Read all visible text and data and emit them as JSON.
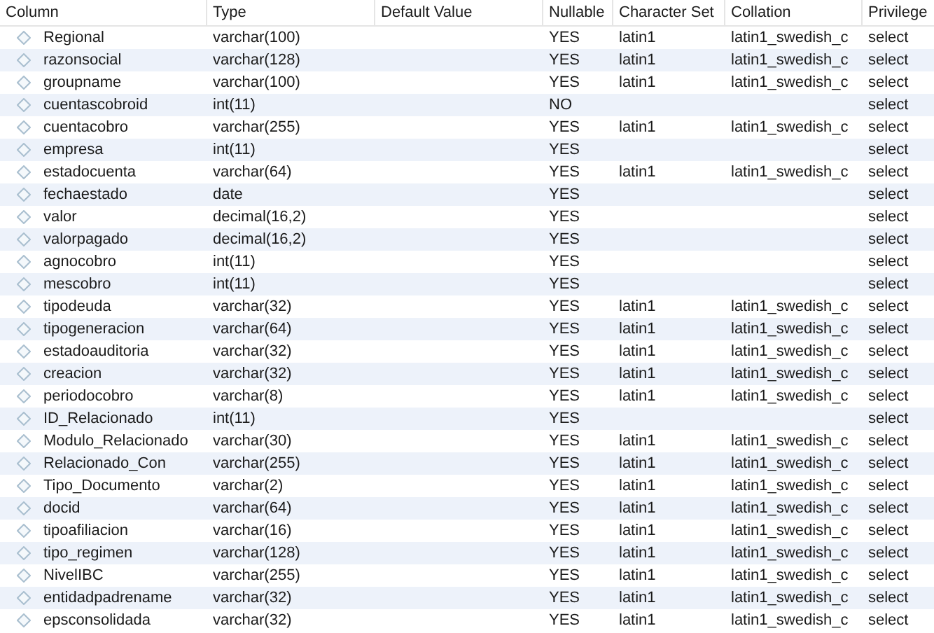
{
  "columns": [
    "Column",
    "Type",
    "Default Value",
    "Nullable",
    "Character Set",
    "Collation",
    "Privilege"
  ],
  "rows": [
    {
      "name": "Regional",
      "type": "varchar(100)",
      "nullable": "YES",
      "charset": "latin1",
      "collation": "latin1_swedish_c",
      "privileges": "select"
    },
    {
      "name": "razonsocial",
      "type": "varchar(128)",
      "nullable": "YES",
      "charset": "latin1",
      "collation": "latin1_swedish_c",
      "privileges": "select"
    },
    {
      "name": "groupname",
      "type": "varchar(100)",
      "nullable": "YES",
      "charset": "latin1",
      "collation": "latin1_swedish_c",
      "privileges": "select"
    },
    {
      "name": "cuentascobroid",
      "type": "int(11)",
      "nullable": "NO",
      "privileges": "select"
    },
    {
      "name": "cuentacobro",
      "type": "varchar(255)",
      "nullable": "YES",
      "charset": "latin1",
      "collation": "latin1_swedish_c",
      "privileges": "select"
    },
    {
      "name": "empresa",
      "type": "int(11)",
      "nullable": "YES",
      "privileges": "select"
    },
    {
      "name": "estadocuenta",
      "type": "varchar(64)",
      "nullable": "YES",
      "charset": "latin1",
      "collation": "latin1_swedish_c",
      "privileges": "select"
    },
    {
      "name": "fechaestado",
      "type": "date",
      "nullable": "YES",
      "privileges": "select"
    },
    {
      "name": "valor",
      "type": "decimal(16,2)",
      "nullable": "YES",
      "privileges": "select"
    },
    {
      "name": "valorpagado",
      "type": "decimal(16,2)",
      "nullable": "YES",
      "privileges": "select"
    },
    {
      "name": "agnocobro",
      "type": "int(11)",
      "nullable": "YES",
      "privileges": "select"
    },
    {
      "name": "mescobro",
      "type": "int(11)",
      "nullable": "YES",
      "privileges": "select"
    },
    {
      "name": "tipodeuda",
      "type": "varchar(32)",
      "nullable": "YES",
      "charset": "latin1",
      "collation": "latin1_swedish_c",
      "privileges": "select"
    },
    {
      "name": "tipogeneracion",
      "type": "varchar(64)",
      "nullable": "YES",
      "charset": "latin1",
      "collation": "latin1_swedish_c",
      "privileges": "select"
    },
    {
      "name": "estadoauditoria",
      "type": "varchar(32)",
      "nullable": "YES",
      "charset": "latin1",
      "collation": "latin1_swedish_c",
      "privileges": "select"
    },
    {
      "name": "creacion",
      "type": "varchar(32)",
      "nullable": "YES",
      "charset": "latin1",
      "collation": "latin1_swedish_c",
      "privileges": "select"
    },
    {
      "name": "periodocobro",
      "type": "varchar(8)",
      "nullable": "YES",
      "charset": "latin1",
      "collation": "latin1_swedish_c",
      "privileges": "select"
    },
    {
      "name": "ID_Relacionado",
      "type": "int(11)",
      "nullable": "YES",
      "privileges": "select"
    },
    {
      "name": "Modulo_Relacionado",
      "type": "varchar(30)",
      "nullable": "YES",
      "charset": "latin1",
      "collation": "latin1_swedish_c",
      "privileges": "select"
    },
    {
      "name": "Relacionado_Con",
      "type": "varchar(255)",
      "nullable": "YES",
      "charset": "latin1",
      "collation": "latin1_swedish_c",
      "privileges": "select"
    },
    {
      "name": "Tipo_Documento",
      "type": "varchar(2)",
      "nullable": "YES",
      "charset": "latin1",
      "collation": "latin1_swedish_c",
      "privileges": "select"
    },
    {
      "name": "docid",
      "type": "varchar(64)",
      "nullable": "YES",
      "charset": "latin1",
      "collation": "latin1_swedish_c",
      "privileges": "select"
    },
    {
      "name": "tipoafiliacion",
      "type": "varchar(16)",
      "nullable": "YES",
      "charset": "latin1",
      "collation": "latin1_swedish_c",
      "privileges": "select"
    },
    {
      "name": "tipo_regimen",
      "type": "varchar(128)",
      "nullable": "YES",
      "charset": "latin1",
      "collation": "latin1_swedish_c",
      "privileges": "select"
    },
    {
      "name": "NivelIBC",
      "type": "varchar(255)",
      "nullable": "YES",
      "charset": "latin1",
      "collation": "latin1_swedish_c",
      "privileges": "select"
    },
    {
      "name": "entidadpadrename",
      "type": "varchar(32)",
      "nullable": "YES",
      "charset": "latin1",
      "collation": "latin1_swedish_c",
      "privileges": "select"
    },
    {
      "name": "epsconsolidada",
      "type": "varchar(32)",
      "nullable": "YES",
      "charset": "latin1",
      "collation": "latin1_swedish_c",
      "privileges": "select"
    }
  ]
}
